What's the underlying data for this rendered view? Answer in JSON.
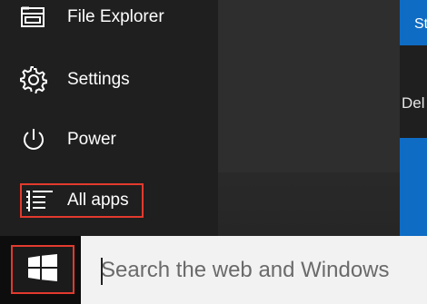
{
  "start_menu": {
    "items": [
      {
        "label": "File Explorer",
        "icon": "file-explorer-icon"
      },
      {
        "label": "Settings",
        "icon": "gear-icon"
      },
      {
        "label": "Power",
        "icon": "power-icon"
      },
      {
        "label": "All apps",
        "icon": "list-icon"
      }
    ],
    "file_explorer_chevron": "›"
  },
  "tiles": {
    "top_tile_text": "St",
    "label_text": "Del"
  },
  "taskbar": {
    "start_button_icon": "windows-logo-icon",
    "search_placeholder": "Search the web and Windows"
  },
  "colors": {
    "accent_blue": "#0f6cc4",
    "highlight_red": "#e23a2e",
    "menu_bg": "#1f1f1f",
    "taskbar_bg": "#0d0d0d",
    "search_bg": "#f2f2f2"
  }
}
